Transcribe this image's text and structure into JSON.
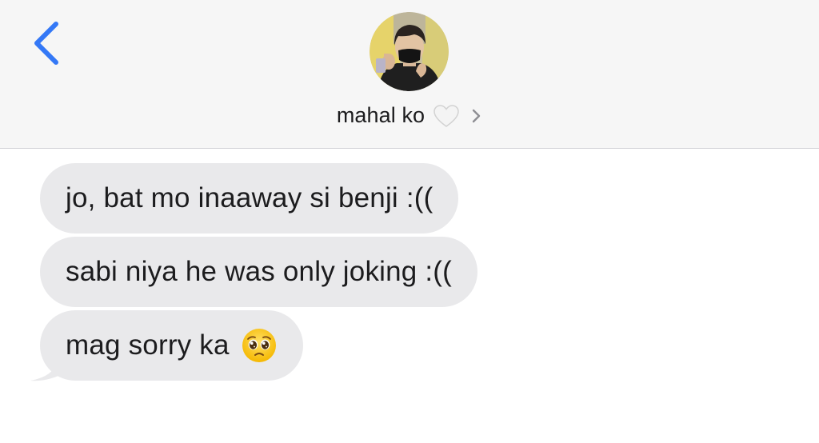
{
  "header": {
    "back_icon": "chevron-left-icon",
    "contact_name": "mahal ko",
    "contact_emoji": "white-heart-icon",
    "details_icon": "chevron-right-icon"
  },
  "messages": [
    {
      "text": "jo, bat mo inaaway si benji :(("
    },
    {
      "text": "sabi niya he was only joking :(("
    },
    {
      "text": "mag sorry ka",
      "emoji": "pleading-face-icon"
    }
  ],
  "colors": {
    "accent": "#3478f6",
    "header_bg": "#f6f6f6",
    "bubble_bg": "#e9e9eb",
    "text": "#1c1c1e"
  }
}
